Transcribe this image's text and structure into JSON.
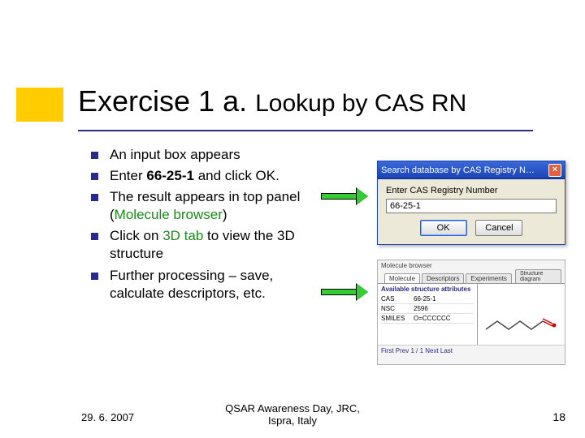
{
  "title_main": "Exercise 1 a.",
  "title_sub": "Lookup by CAS RN",
  "bullets": [
    {
      "pre": "An input box appears",
      "bold": "",
      "post": ""
    },
    {
      "pre": "Enter ",
      "bold": "66-25-1",
      "post": " and click OK."
    },
    {
      "pre": "The result appears in top panel (",
      "bold": "",
      "post": "",
      "green": "Molecule browser",
      "tail": ")"
    },
    {
      "pre": "Click on ",
      "bold": "",
      "green": "3D tab",
      "post": " to view the 3D structure"
    },
    {
      "pre": "Further processing – save, calculate descriptors, etc.",
      "bold": "",
      "post": ""
    }
  ],
  "dialog": {
    "title": "Search database by CAS Registry N…",
    "label": "Enter CAS Registry Number",
    "value": "66-25-1",
    "ok": "OK",
    "cancel": "Cancel",
    "close": "×"
  },
  "panel": {
    "header": "Molecule browser",
    "tabs": [
      "Molecule",
      "Descriptors",
      "Experiments"
    ],
    "side_tab": "Structure diagram",
    "attr_header": "Available structure attributes",
    "rows": [
      {
        "k": "CAS",
        "v": "66-25-1"
      },
      {
        "k": "NSC",
        "v": "2596"
      },
      {
        "k": "SMILES",
        "v": "O=CCCCCC"
      }
    ],
    "pager": "First  Prev  1 / 1  Next  Last"
  },
  "footer": {
    "date": "29. 6. 2007",
    "center1": "QSAR Awareness Day, JRC,",
    "center2": "Ispra, Italy",
    "page": "18"
  }
}
